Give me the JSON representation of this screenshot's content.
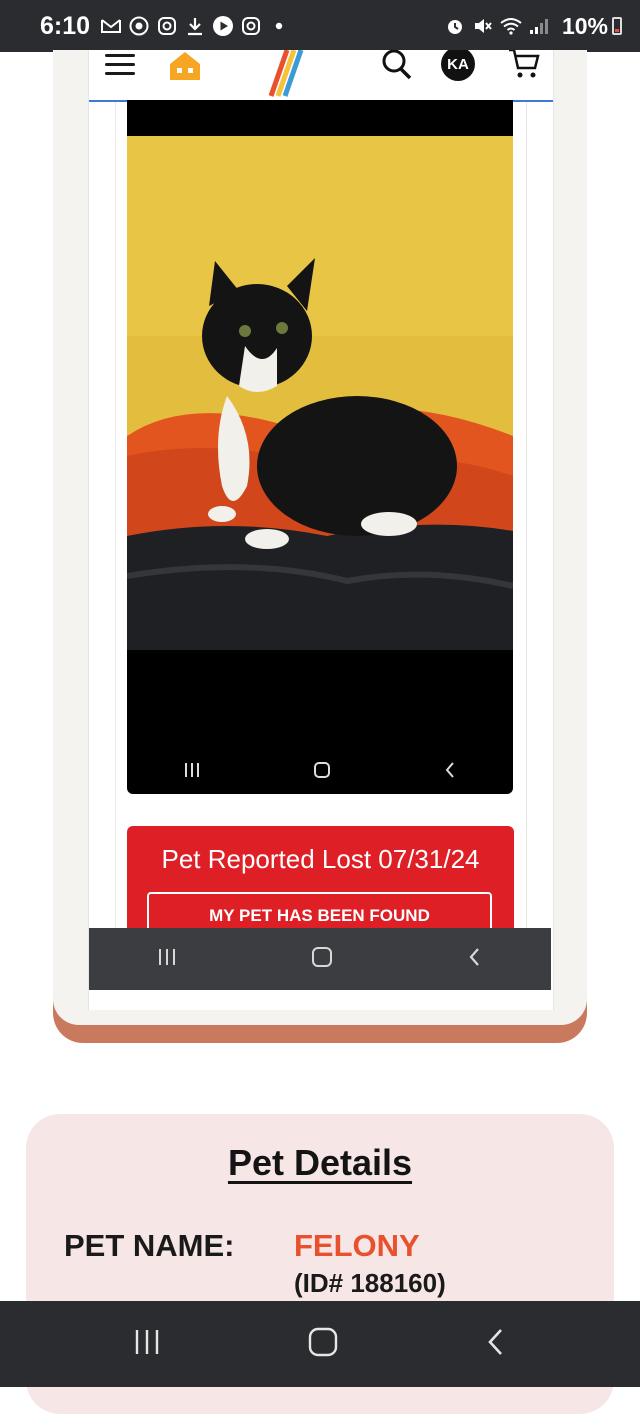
{
  "status_bar": {
    "time": "6:10",
    "battery_percent": "10%",
    "left_icons": [
      "gmail-icon",
      "chrome-icon",
      "instagram-icon",
      "download-icon",
      "youtube-icon",
      "instagram-icon",
      "dot-icon"
    ],
    "right_icons": [
      "alarm-icon",
      "mute-icon",
      "wifi-icon",
      "signal-icon",
      "battery-icon"
    ]
  },
  "embedded_screenshot": {
    "header": {
      "avatar_initials": "KA",
      "icons": [
        "menu-icon",
        "home-icon",
        "logo-rainbow",
        "search-icon",
        "cart-icon"
      ]
    },
    "photo": {
      "description_icon": "cat-photo"
    },
    "lost_banner": {
      "text": "Pet Reported Lost 07/31/24",
      "found_button": "MY PET HAS BEEN FOUND"
    },
    "colors": {
      "banner": "#de1f26",
      "card_shadow": "#c97a5e"
    }
  },
  "pet_details": {
    "title": "Pet Details",
    "name_label": "PET NAME:",
    "name_value": "FELONY",
    "pet_id": "(ID# 188160)"
  },
  "colors": {
    "details_background": "#f6e6e6",
    "pet_name_accent": "#e8502e"
  }
}
